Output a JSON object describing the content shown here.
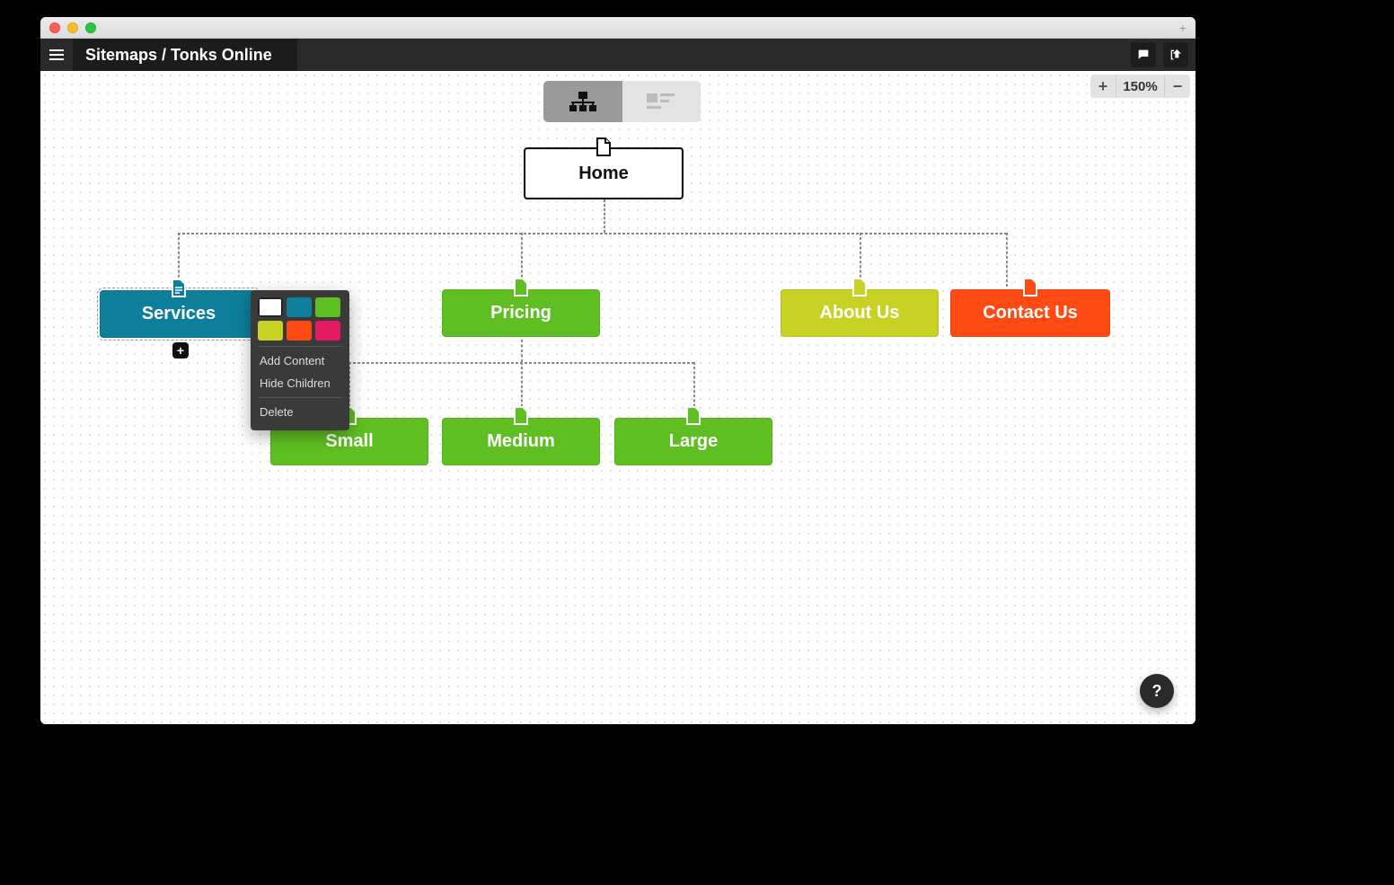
{
  "header": {
    "breadcrumb": "Sitemaps / Tonks Online"
  },
  "zoom": {
    "label": "150%"
  },
  "nodes": {
    "home": "Home",
    "services": "Services",
    "pricing": "Pricing",
    "about": "About Us",
    "contact": "Contact Us",
    "small": "Small",
    "medium": "Medium",
    "large": "Large"
  },
  "contextMenu": {
    "addContent": "Add Content",
    "hideChildren": "Hide Children",
    "delete": "Delete"
  },
  "colors": {
    "teal": "#0e7f9a",
    "green": "#5fbf22",
    "olive": "#c7d224",
    "orange": "#ff4a13",
    "magenta": "#e61a63",
    "white": "#ffffff"
  },
  "help": "?"
}
